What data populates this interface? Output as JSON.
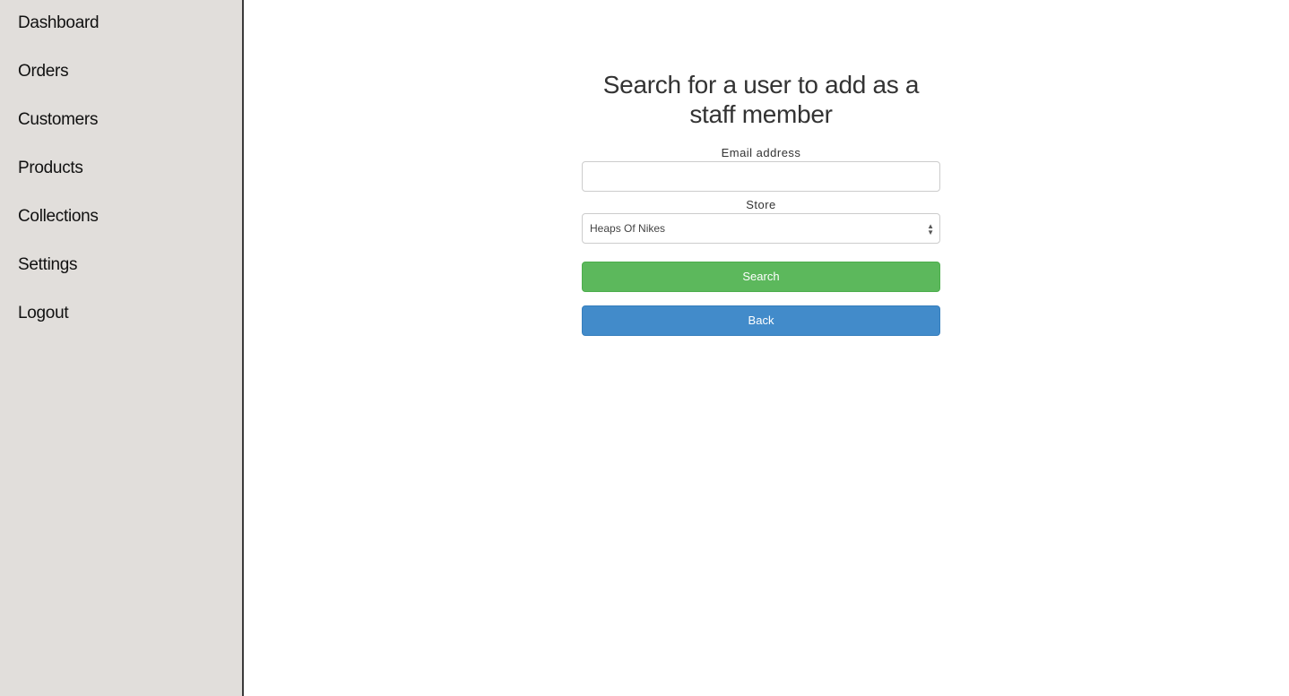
{
  "sidebar": {
    "items": [
      {
        "label": "Dashboard"
      },
      {
        "label": "Orders"
      },
      {
        "label": "Customers"
      },
      {
        "label": "Products"
      },
      {
        "label": "Collections"
      },
      {
        "label": "Settings"
      },
      {
        "label": "Logout"
      }
    ]
  },
  "form": {
    "title": "Search for a user to add as a staff member",
    "email_label": "Email address",
    "email_value": "",
    "store_label": "Store",
    "store_selected": "Heaps Of Nikes",
    "search_label": "Search",
    "back_label": "Back"
  },
  "colors": {
    "search": "#5cb85c",
    "back": "#428bca",
    "sidebar_bg": "#e1dedb"
  }
}
